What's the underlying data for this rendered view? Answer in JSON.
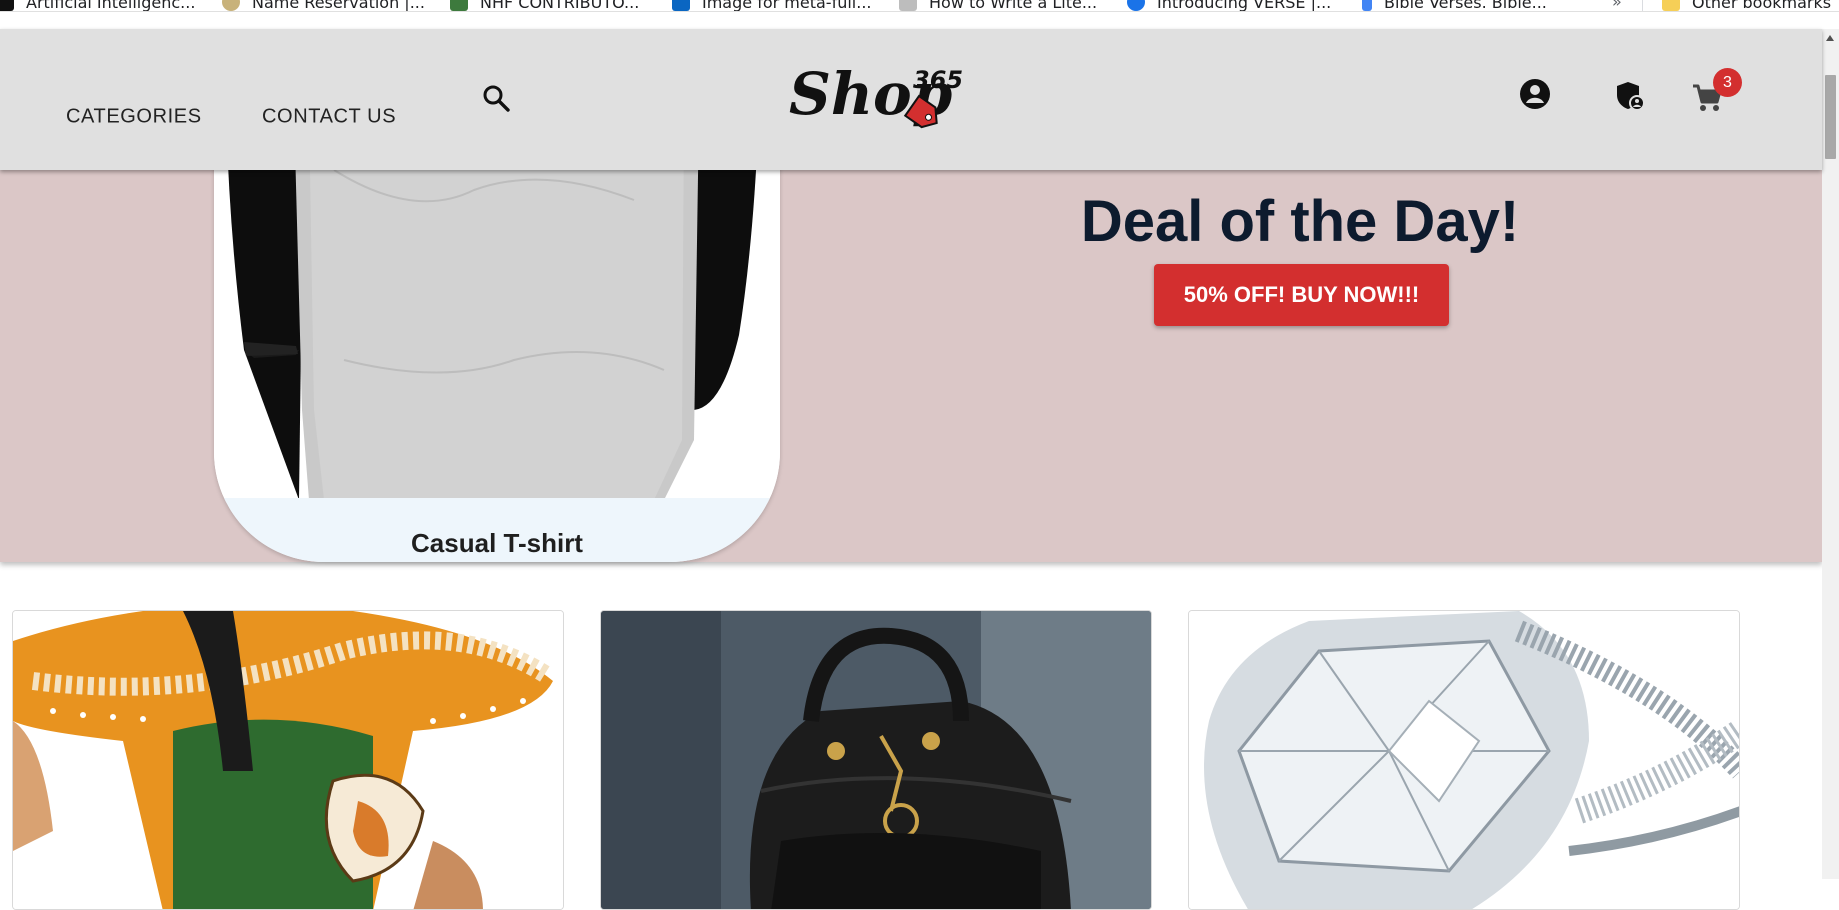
{
  "bookmarks": [
    {
      "label": "Artificial Intelligenc...",
      "icon": "ai-favicon",
      "color": "#202124"
    },
    {
      "label": "Name Reservation |...",
      "icon": "coat-of-arms-favicon",
      "color": "#7a6a3a"
    },
    {
      "label": "NHF CONTRIBUTO...",
      "icon": "nhf-favicon",
      "color": "#3d7a3d"
    },
    {
      "label": "Image for meta-full...",
      "icon": "linkedin-favicon",
      "color": "#0a66c2"
    },
    {
      "label": "How to Write a Lite...",
      "icon": "book-favicon",
      "color": "#8a8a8a"
    },
    {
      "label": "Introducing VERSE |...",
      "icon": "verse-favicon",
      "color": "#1a73e8"
    },
    {
      "label": "Bible Verses. Bible...",
      "icon": "docs-favicon",
      "color": "#4285f4"
    }
  ],
  "bookmarks_more": "»",
  "other_bookmarks": "Other bookmarks",
  "nav": {
    "categories": "CATEGORIES",
    "contact": "CONTACT US"
  },
  "logo": {
    "text": "Shop",
    "superscript": "365"
  },
  "cart": {
    "count": "3"
  },
  "hero": {
    "featured_caption": "Casual T-shirt",
    "deal_title": "Deal of the Day!",
    "deal_button": "50% OFF! BUY NOW!!!"
  },
  "products": [
    {
      "name": "ankara-dress",
      "icon": "dress-image"
    },
    {
      "name": "leather-backpack",
      "icon": "backpack-image"
    },
    {
      "name": "diamond-ring",
      "icon": "ring-image"
    }
  ],
  "colors": {
    "header_bg": "#e0e0e0",
    "hero_bg": "#dbc7c7",
    "accent_red": "#d32f2f",
    "deal_text": "#0d1b2e"
  }
}
